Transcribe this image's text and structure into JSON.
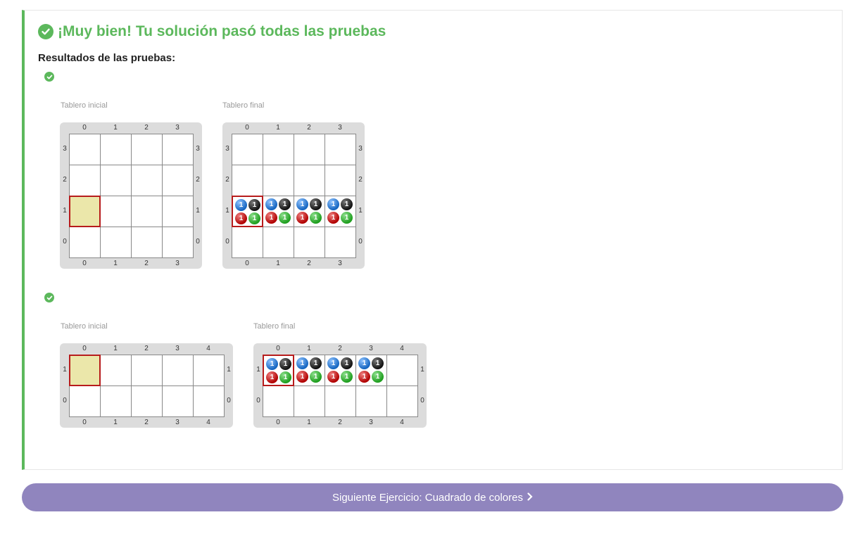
{
  "result": {
    "title": "¡Muy bien! Tu solución pasó todas las pruebas",
    "subtitle": "Resultados de las pruebas:",
    "color_success": "#5cb85c"
  },
  "tests": [
    {
      "initial_label": "Tablero inicial",
      "final_label": "Tablero final",
      "cols": 4,
      "rows": 4,
      "initial_head": [
        0,
        1
      ],
      "final_head": [
        0,
        1
      ],
      "final_cells": [
        {
          "x": 0,
          "y": 1,
          "balls": {
            "blue": "1",
            "black": "1",
            "red": "1",
            "green": "1"
          }
        },
        {
          "x": 1,
          "y": 1,
          "balls": {
            "blue": "1",
            "black": "1",
            "red": "1",
            "green": "1"
          }
        },
        {
          "x": 2,
          "y": 1,
          "balls": {
            "blue": "1",
            "black": "1",
            "red": "1",
            "green": "1"
          }
        },
        {
          "x": 3,
          "y": 1,
          "balls": {
            "blue": "1",
            "black": "1",
            "red": "1",
            "green": "1"
          }
        }
      ]
    },
    {
      "initial_label": "Tablero inicial",
      "final_label": "Tablero final",
      "cols": 5,
      "rows": 2,
      "initial_head": [
        0,
        1
      ],
      "final_head": [
        0,
        1
      ],
      "final_cells": [
        {
          "x": 0,
          "y": 1,
          "balls": {
            "blue": "1",
            "black": "1",
            "red": "1",
            "green": "1"
          }
        },
        {
          "x": 1,
          "y": 1,
          "balls": {
            "blue": "1",
            "black": "1",
            "red": "1",
            "green": "1"
          }
        },
        {
          "x": 2,
          "y": 1,
          "balls": {
            "blue": "1",
            "black": "1",
            "red": "1",
            "green": "1"
          }
        },
        {
          "x": 3,
          "y": 1,
          "balls": {
            "blue": "1",
            "black": "1",
            "red": "1",
            "green": "1"
          }
        }
      ]
    }
  ],
  "next_button": {
    "label": "Siguiente Ejercicio: Cuadrado de colores",
    "icon": "chevron-right-icon",
    "color": "#9085be"
  }
}
